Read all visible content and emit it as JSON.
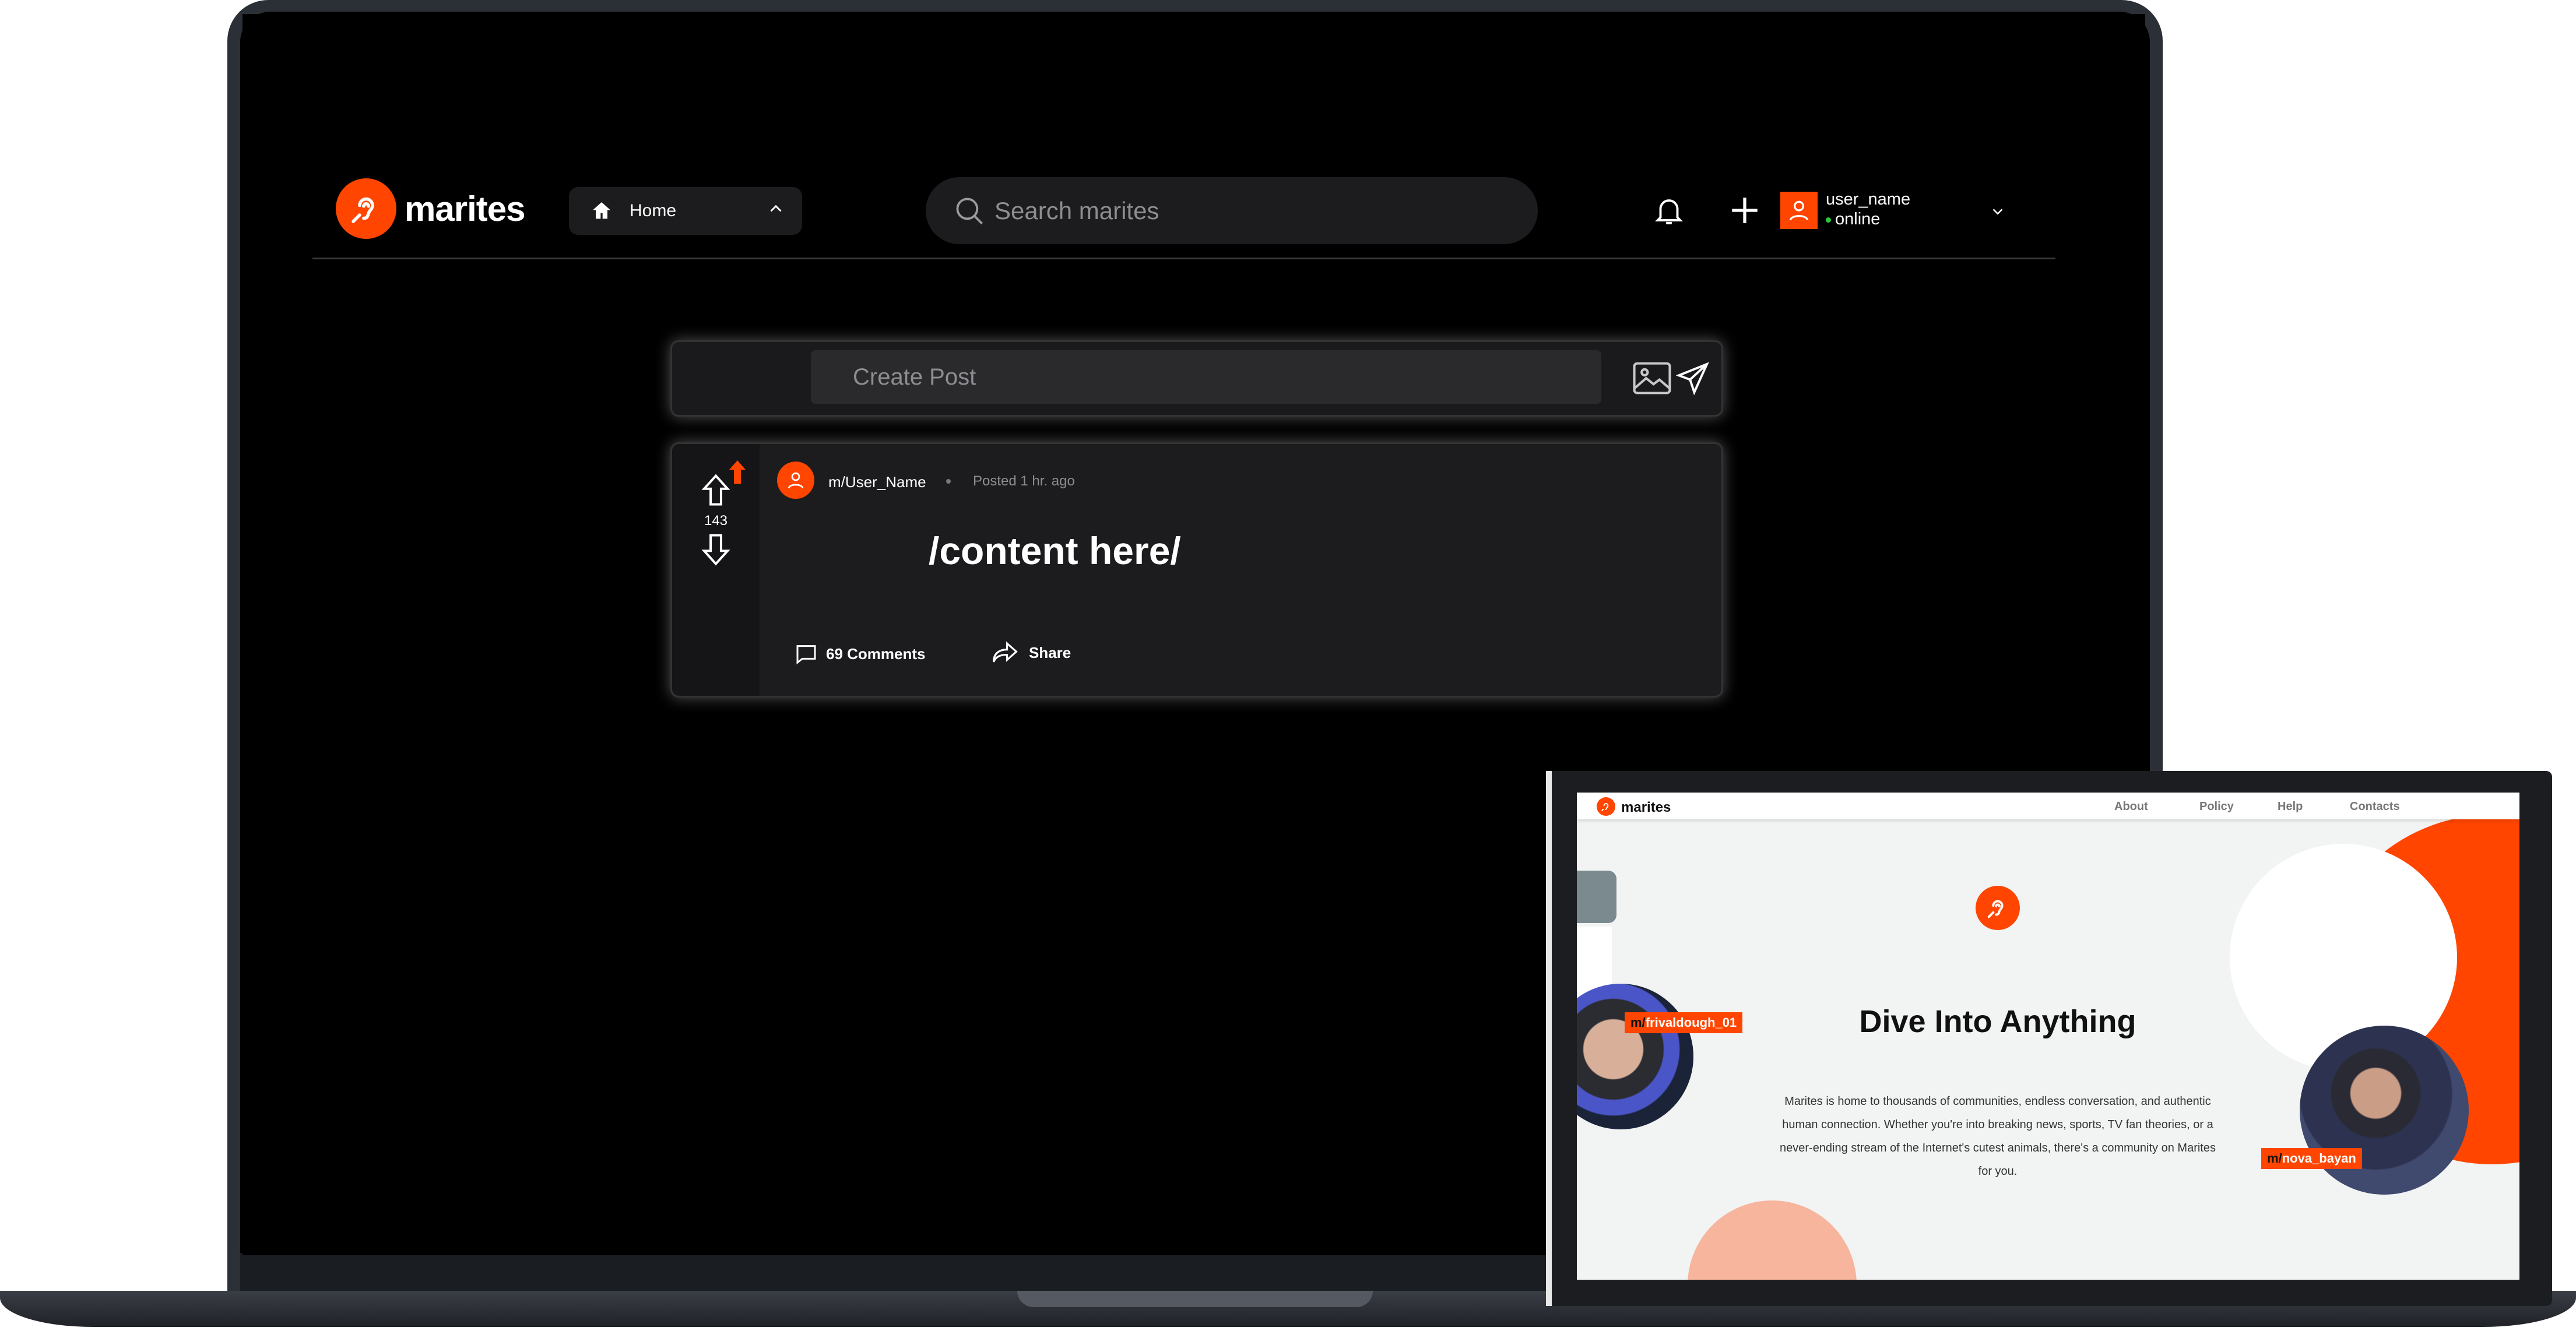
{
  "laptop": {
    "brand": "marites",
    "home_select": {
      "label": "Home"
    },
    "search": {
      "placeholder": "Search marites"
    },
    "user": {
      "name": "user_name",
      "status": "online"
    },
    "create_post": {
      "placeholder": "Create Post"
    },
    "post": {
      "votes": "143",
      "author": "m/User_Name",
      "time": "Posted 1 hr. ago",
      "content": "/content here/",
      "comments_label": "69 Comments",
      "share_label": "Share"
    }
  },
  "tablet": {
    "brand": "marites",
    "nav_links": [
      "About",
      "Policy",
      "Help",
      "Contacts"
    ],
    "title": "Dive Into Anything",
    "description": "Marites is home to thousands of communities, endless conversation, and authentic human connection. Whether you're into breaking news, sports, TV fan theories, or a never-ending stream of the Internet's cutest animals, there's a community on Marites for you.",
    "tag_left": {
      "prefix": "m/",
      "name": "frivaldough_01"
    },
    "tag_right": {
      "prefix": "m/",
      "name": "nova_bayan"
    }
  },
  "colors": {
    "accent": "#ff4500",
    "background": "#000000",
    "surface": "#1c1c1e",
    "online": "#27c93f"
  },
  "icons": [
    "ear-logo-icon",
    "home-icon",
    "chevron-up-icon",
    "search-icon",
    "bell-icon",
    "plus-icon",
    "user-icon",
    "chevron-down-icon",
    "image-icon",
    "send-icon",
    "upvote-icon",
    "downvote-icon",
    "comment-icon",
    "share-icon"
  ]
}
